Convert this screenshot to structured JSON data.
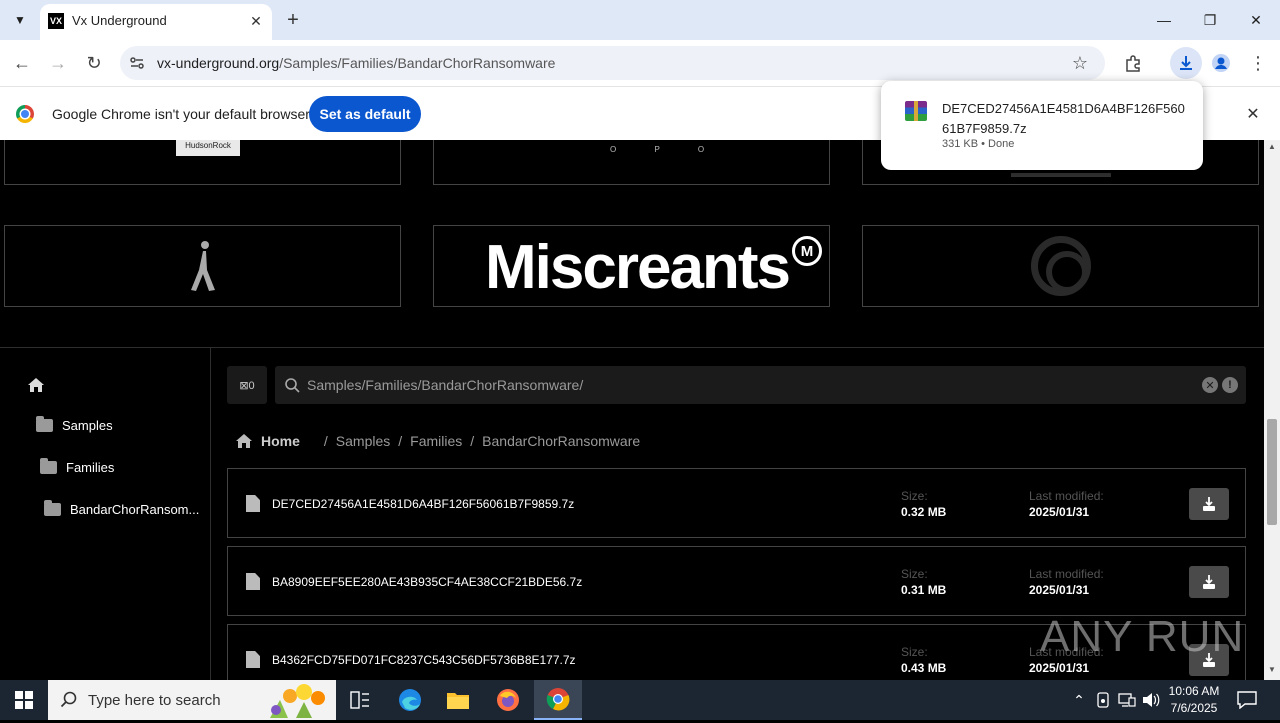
{
  "browser": {
    "tab_title": "Vx Underground",
    "tab_favicon_text": "VX",
    "url_host": "vx-underground.org",
    "url_path": "/Samples/Families/BandarChorRansomware"
  },
  "infobar": {
    "message": "Google Chrome isn't your default browser",
    "button_label": "Set as default"
  },
  "download_bubble": {
    "filename": "DE7CED27456A1E4581D6A4BF126F56061B7F9859.7z",
    "status": "331 KB • Done"
  },
  "sponsors": {
    "hudson_rock_text": "HudsonRock",
    "sponsor2_text": "O P O",
    "miscreants_text": "Miscreants",
    "miscreants_mark": "M"
  },
  "sidebar": {
    "items": [
      {
        "label": "Samples"
      },
      {
        "label": "Families"
      },
      {
        "label": "BandarChorRansom..."
      }
    ]
  },
  "search": {
    "value": "Samples/Families/BandarChorRansomware/",
    "collapse_label": "⊠0"
  },
  "breadcrumb": {
    "home": "Home",
    "parts": [
      "Samples",
      "Families",
      "BandarChorRansomware"
    ]
  },
  "files": {
    "size_label": "Size:",
    "modified_label": "Last modified:",
    "rows": [
      {
        "name": "DE7CED27456A1E4581D6A4BF126F56061B7F9859.7z",
        "size": "0.32 MB",
        "modified": "2025/01/31"
      },
      {
        "name": "BA8909EEF5EE280AE43B935CF4AE38CCF21BDE56.7z",
        "size": "0.31 MB",
        "modified": "2025/01/31"
      },
      {
        "name": "B4362FCD75FD071FC8237C543C56DF5736B8E177.7z",
        "size": "0.43 MB",
        "modified": "2025/01/31"
      }
    ]
  },
  "watermark": "ANY RUN",
  "taskbar": {
    "search_placeholder": "Type here to search",
    "time": "10:06 AM",
    "date": "7/6/2025"
  },
  "colors": {
    "accent": "#0b57d0",
    "page_bg": "#000000",
    "taskbar_bg": "#1c2532"
  }
}
